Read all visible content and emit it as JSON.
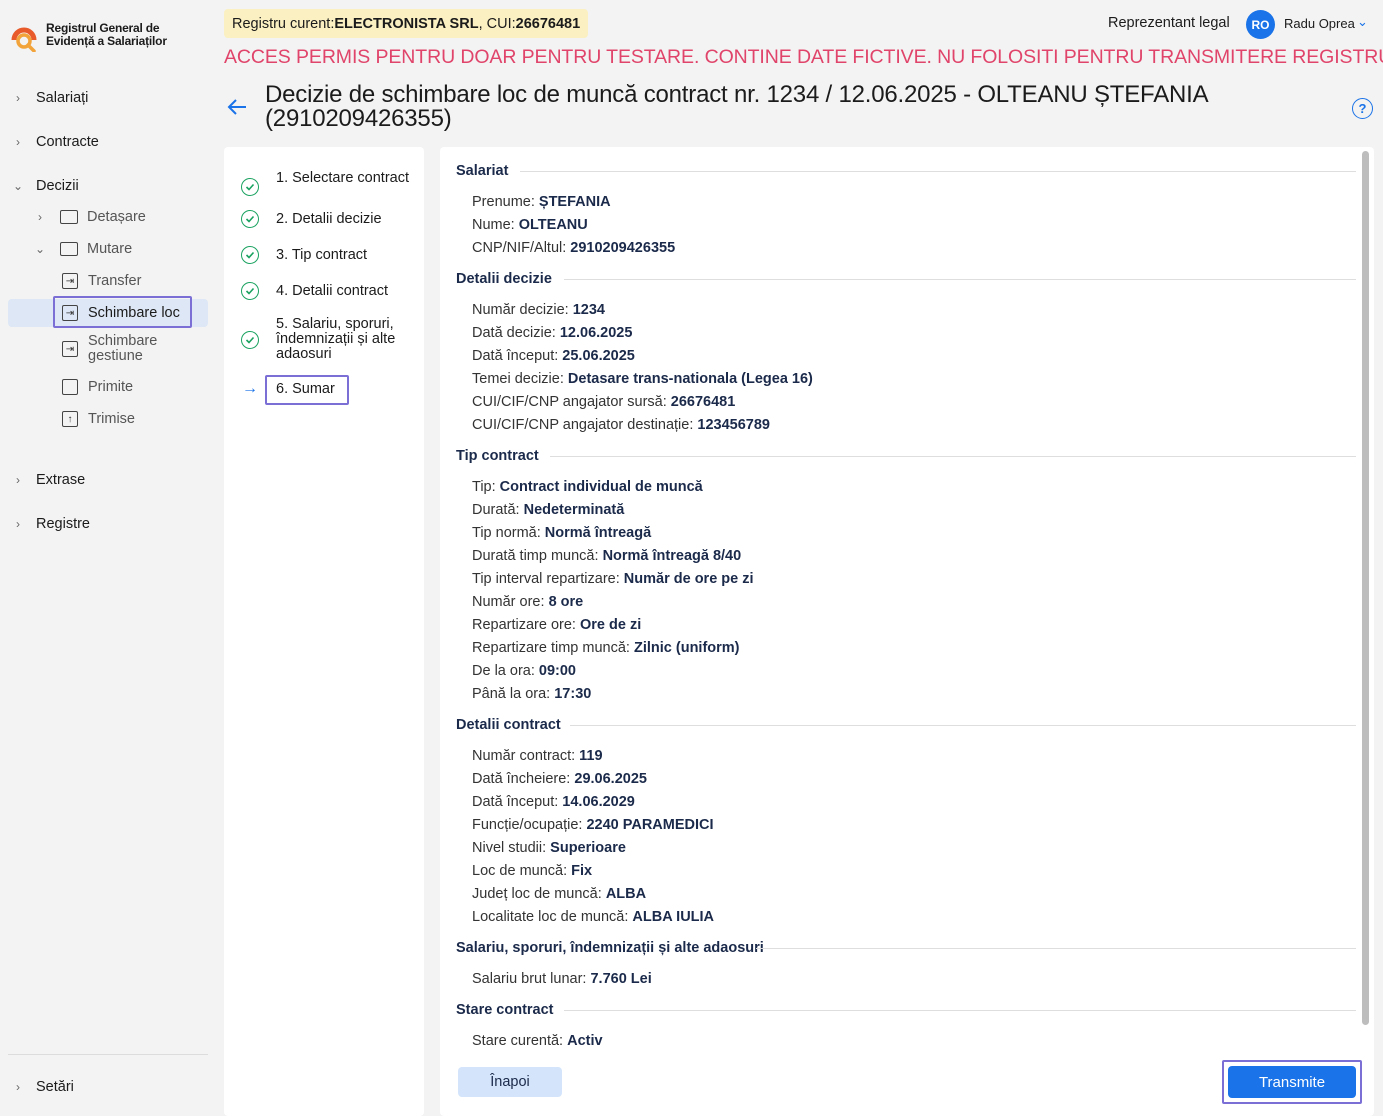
{
  "app": {
    "logo_line1": "Registrul General de",
    "logo_line2": "Evidență a Salariaților"
  },
  "sidebar": {
    "items": [
      {
        "label": "Salariați"
      },
      {
        "label": "Contracte"
      },
      {
        "label": "Decizii"
      },
      {
        "label": "Extrase"
      },
      {
        "label": "Registre"
      },
      {
        "label": "Setări"
      }
    ],
    "decizii_sub": [
      {
        "label": "Detașare"
      },
      {
        "label": "Mutare"
      },
      {
        "label": "Transfer"
      },
      {
        "label": "Schimbare loc"
      },
      {
        "label": "Schimbare gestiune"
      },
      {
        "label": "Primite"
      },
      {
        "label": "Trimise"
      }
    ]
  },
  "header": {
    "registry_prefix": "Registru curent: ",
    "company": "ELECTRONISTA SRL",
    "cui_prefix": ", CUI: ",
    "cui": "26676481",
    "role": "Reprezentant legal",
    "avatar_initials": "RO",
    "user_name": "Radu Oprea",
    "warning": "ACCES PERMIS PENTRU DOAR PENTRU TESTARE. CONTINE DATE FICTIVE. NU FOLOSITI PENTRU TRANSMITERE REGISTRU"
  },
  "page": {
    "title": "Decizie de schimbare loc de muncă contract nr. 1234 / 12.06.2025 - OLTEANU  ȘTEFANIA (2910209426355)"
  },
  "steps": [
    {
      "label": "1. Selectare contract",
      "status": "done"
    },
    {
      "label": "2. Detalii decizie",
      "status": "done"
    },
    {
      "label": "3. Tip contract",
      "status": "done"
    },
    {
      "label": "4. Detalii contract",
      "status": "done"
    },
    {
      "label": "5. Salariu, sporuri, îndemnizații și alte adaosuri",
      "status": "done"
    },
    {
      "label": "6. Sumar",
      "status": "current"
    }
  ],
  "summary": {
    "salariat": {
      "title": "Salariat",
      "rows": [
        {
          "label": "Prenume: ",
          "value": "ȘTEFANIA"
        },
        {
          "label": "Nume: ",
          "value": "OLTEANU"
        },
        {
          "label": "CNP/NIF/Altul: ",
          "value": "2910209426355"
        }
      ]
    },
    "detalii_decizie": {
      "title": "Detalii decizie",
      "rows": [
        {
          "label": "Număr decizie: ",
          "value": "1234"
        },
        {
          "label": "Dată decizie: ",
          "value": "12.06.2025"
        },
        {
          "label": "Dată început: ",
          "value": "25.06.2025"
        },
        {
          "label": "Temei decizie: ",
          "value": "Detasare trans-nationala (Legea 16)"
        },
        {
          "label": "CUI/CIF/CNP angajator sursă: ",
          "value": "26676481"
        },
        {
          "label": "CUI/CIF/CNP angajator destinație: ",
          "value": "123456789"
        }
      ]
    },
    "tip_contract": {
      "title": "Tip contract",
      "rows": [
        {
          "label": "Tip: ",
          "value": "Contract individual de muncă"
        },
        {
          "label": "Durată: ",
          "value": "Nedeterminată"
        },
        {
          "label": "Tip normă: ",
          "value": "Normă întreagă"
        },
        {
          "label": "Durată timp muncă: ",
          "value": "Normă întreagă 8/40"
        },
        {
          "label": "Tip interval repartizare: ",
          "value": "Număr de ore pe zi"
        },
        {
          "label": "Număr ore: ",
          "value": "8 ore"
        },
        {
          "label": "Repartizare ore: ",
          "value": "Ore de zi"
        },
        {
          "label": "Repartizare timp muncă: ",
          "value": "Zilnic (uniform)"
        },
        {
          "label": "De la ora: ",
          "value": "09:00"
        },
        {
          "label": "Până la ora: ",
          "value": "17:30"
        }
      ]
    },
    "detalii_contract": {
      "title": "Detalii contract",
      "rows": [
        {
          "label": "Număr contract: ",
          "value": "119"
        },
        {
          "label": "Dată încheiere: ",
          "value": "29.06.2025"
        },
        {
          "label": "Dată început: ",
          "value": "14.06.2029"
        },
        {
          "label": "Funcție/ocupație: ",
          "value": "2240 PARAMEDICI"
        },
        {
          "label": "Nivel studii: ",
          "value": "Superioare"
        },
        {
          "label": "Loc de muncă: ",
          "value": "Fix"
        },
        {
          "label": "Județ loc de muncă: ",
          "value": "ALBA"
        },
        {
          "label": "Localitate loc de muncă: ",
          "value": "ALBA IULIA"
        }
      ]
    },
    "salariu": {
      "title": "Salariu, sporuri, îndemnizații și alte adaosuri",
      "rows": [
        {
          "label": "Salariu brut lunar: ",
          "value": "7.760 Lei"
        }
      ]
    },
    "stare": {
      "title": "Stare contract",
      "rows": [
        {
          "label": "Stare curentă: ",
          "value": "Activ"
        }
      ]
    }
  },
  "actions": {
    "back_label": "Înapoi",
    "submit_label": "Transmite"
  },
  "colors": {
    "accent": "#1a73e8",
    "warning": "#e0446a",
    "success": "#1aa260",
    "focus": "#7b6fd6"
  }
}
